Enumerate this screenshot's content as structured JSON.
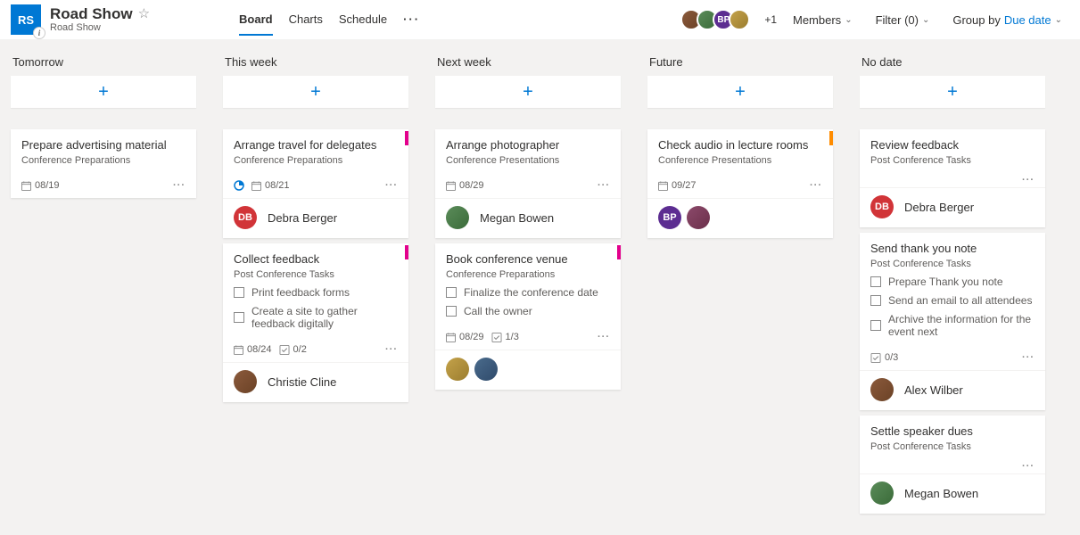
{
  "header": {
    "badge": "RS",
    "title": "Road Show",
    "subtitle": "Road Show",
    "tabs": [
      "Board",
      "Charts",
      "Schedule"
    ],
    "plus_count": "+1",
    "members_label": "Members",
    "filter_label": "Filter (0)",
    "group_label": "Group by",
    "group_value": "Due date"
  },
  "columns": [
    {
      "title": "Tomorrow",
      "cards": [
        {
          "title": "Prepare advertising material",
          "bucket": "Conference Preparations",
          "date": "08/19",
          "assignees": []
        }
      ]
    },
    {
      "title": "This week",
      "cards": [
        {
          "title": "Arrange travel for delegates",
          "bucket": "Conference Preparations",
          "tag": "pink",
          "progress": true,
          "date": "08/21",
          "assignees": [
            {
              "initials": "DB",
              "cls": "db",
              "name": "Debra Berger"
            }
          ]
        },
        {
          "title": "Collect feedback",
          "bucket": "Post Conference Tasks",
          "tag": "pink",
          "checks": [
            "Print feedback forms",
            "Create a site to gather feedback digitally"
          ],
          "date": "08/24",
          "checklist": "0/2",
          "assignees": [
            {
              "initials": "",
              "cls": "a1",
              "name": "Christie Cline"
            }
          ]
        }
      ]
    },
    {
      "title": "Next week",
      "cards": [
        {
          "title": "Arrange photographer",
          "bucket": "Conference Presentations",
          "date": "08/29",
          "assignees": [
            {
              "initials": "",
              "cls": "a2",
              "name": "Megan Bowen"
            }
          ]
        },
        {
          "title": "Book conference venue",
          "bucket": "Conference Preparations",
          "tag": "pink",
          "checks": [
            "Finalize the conference date",
            "Call the owner"
          ],
          "date": "08/29",
          "checklist": "1/3",
          "assignees": [
            {
              "initials": "",
              "cls": "a3",
              "name": ""
            },
            {
              "initials": "",
              "cls": "a4",
              "name": ""
            }
          ]
        }
      ]
    },
    {
      "title": "Future",
      "cards": [
        {
          "title": "Check audio in lecture rooms",
          "bucket": "Conference Presentations",
          "tag": "orange",
          "date": "09/27",
          "assignees": [
            {
              "initials": "BP",
              "cls": "bp",
              "name": ""
            },
            {
              "initials": "",
              "cls": "a5",
              "name": ""
            }
          ]
        }
      ]
    },
    {
      "title": "No date",
      "cards": [
        {
          "title": "Review feedback",
          "bucket": "Post Conference Tasks",
          "assignees": [
            {
              "initials": "DB",
              "cls": "db",
              "name": "Debra Berger"
            }
          ]
        },
        {
          "title": "Send thank you note",
          "bucket": "Post Conference Tasks",
          "checks": [
            "Prepare Thank you note",
            "Send an email to all attendees",
            "Archive the information for the event next"
          ],
          "checklist": "0/3",
          "assignees": [
            {
              "initials": "",
              "cls": "a1",
              "name": "Alex Wilber"
            }
          ]
        },
        {
          "title": "Settle speaker dues",
          "bucket": "Post Conference Tasks",
          "assignees": [
            {
              "initials": "",
              "cls": "a2",
              "name": "Megan Bowen"
            }
          ]
        }
      ]
    }
  ]
}
